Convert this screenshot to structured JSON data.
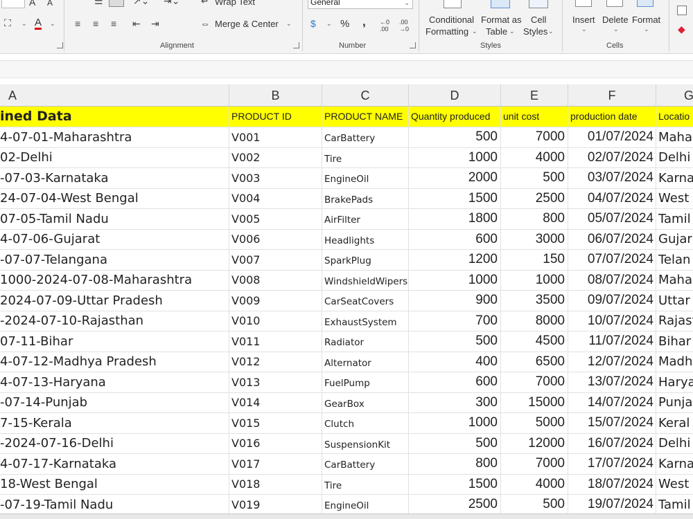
{
  "ribbon": {
    "font": {
      "grow": "A",
      "shrink": "A",
      "fill_icon": "paint-bucket-icon",
      "font_color_label": "A",
      "font_color": "#e00000"
    },
    "alignment": {
      "wrap_text": "Wrap Text",
      "merge_center": "Merge & Center",
      "group_label": "Alignment"
    },
    "number": {
      "format_value": "General",
      "percent": "%",
      "comma": ",",
      "inc_decimal": "←0 .00",
      "dec_decimal": ".00 →0",
      "group_label": "Number"
    },
    "styles": {
      "conditional_line1": "Conditional",
      "conditional_line2": "Formatting",
      "format_table_line1": "Format as",
      "format_table_line2": "Table",
      "cell_styles_line1": "Cell",
      "cell_styles_line2": "Styles",
      "group_label": "Styles"
    },
    "cells": {
      "insert": "Insert",
      "delete": "Delete",
      "format": "Format",
      "group_label": "Cells"
    }
  },
  "columns": [
    "A",
    "B",
    "C",
    "D",
    "E",
    "F",
    "G"
  ],
  "header_row": {
    "a": "ined Data",
    "b": "PRODUCT ID",
    "c": "PRODUCT NAME",
    "d": "Quantity produced",
    "e": "unit cost",
    "f": "production date",
    "g": "Locatio"
  },
  "rows": [
    {
      "a": "4-07-01-Maharashtra",
      "b": "V001",
      "c": "CarBattery",
      "d": "500",
      "e": "7000",
      "f": "01/07/2024",
      "g": "Maha"
    },
    {
      "a": "02-Delhi",
      "b": "V002",
      "c": "Tire",
      "d": "1000",
      "e": "4000",
      "f": "02/07/2024",
      "g": "Delhi"
    },
    {
      "a": "-07-03-Karnataka",
      "b": "V003",
      "c": "EngineOil",
      "d": "2000",
      "e": "500",
      "f": "03/07/2024",
      "g": "Karna"
    },
    {
      "a": "24-07-04-West Bengal",
      "b": "V004",
      "c": "BrakePads",
      "d": "1500",
      "e": "2500",
      "f": "04/07/2024",
      "g": "West"
    },
    {
      "a": "07-05-Tamil Nadu",
      "b": "V005",
      "c": "AirFilter",
      "d": "1800",
      "e": "800",
      "f": "05/07/2024",
      "g": "Tamil"
    },
    {
      "a": "4-07-06-Gujarat",
      "b": "V006",
      "c": "Headlights",
      "d": "600",
      "e": "3000",
      "f": "06/07/2024",
      "g": "Gujar"
    },
    {
      "a": "-07-07-Telangana",
      "b": "V007",
      "c": "SparkPlug",
      "d": "1200",
      "e": "150",
      "f": "07/07/2024",
      "g": "Telan"
    },
    {
      "a": "1000-2024-07-08-Maharashtra",
      "b": "V008",
      "c": "WindshieldWipers",
      "d": "1000",
      "e": "1000",
      "f": "08/07/2024",
      "g": "Maha"
    },
    {
      "a": "2024-07-09-Uttar Pradesh",
      "b": "V009",
      "c": "CarSeatCovers",
      "d": "900",
      "e": "3500",
      "f": "09/07/2024",
      "g": "Uttar"
    },
    {
      "a": "-2024-07-10-Rajasthan",
      "b": "V010",
      "c": "ExhaustSystem",
      "d": "700",
      "e": "8000",
      "f": "10/07/2024",
      "g": "Rajast"
    },
    {
      "a": "07-11-Bihar",
      "b": "V011",
      "c": "Radiator",
      "d": "500",
      "e": "4500",
      "f": "11/07/2024",
      "g": "Bihar"
    },
    {
      "a": "4-07-12-Madhya Pradesh",
      "b": "V012",
      "c": "Alternator",
      "d": "400",
      "e": "6500",
      "f": "12/07/2024",
      "g": "Madh"
    },
    {
      "a": "4-07-13-Haryana",
      "b": "V013",
      "c": "FuelPump",
      "d": "600",
      "e": "7000",
      "f": "13/07/2024",
      "g": "Harya"
    },
    {
      "a": "-07-14-Punjab",
      "b": "V014",
      "c": "GearBox",
      "d": "300",
      "e": "15000",
      "f": "14/07/2024",
      "g": "Punja"
    },
    {
      "a": "7-15-Kerala",
      "b": "V015",
      "c": "Clutch",
      "d": "1000",
      "e": "5000",
      "f": "15/07/2024",
      "g": "Keral"
    },
    {
      "a": "-2024-07-16-Delhi",
      "b": "V016",
      "c": "SuspensionKit",
      "d": "500",
      "e": "12000",
      "f": "16/07/2024",
      "g": "Delhi"
    },
    {
      "a": "4-07-17-Karnataka",
      "b": "V017",
      "c": "CarBattery",
      "d": "800",
      "e": "7000",
      "f": "17/07/2024",
      "g": "Karna"
    },
    {
      "a": "18-West Bengal",
      "b": "V018",
      "c": "Tire",
      "d": "1500",
      "e": "4000",
      "f": "18/07/2024",
      "g": "West"
    },
    {
      "a": "-07-19-Tamil Nadu",
      "b": "V019",
      "c": "EngineOil",
      "d": "2500",
      "e": "500",
      "f": "19/07/2024",
      "g": "Tamil"
    }
  ],
  "colors": {
    "header_fill": "#ffff00",
    "ribbon_bg": "#f3f3f3",
    "gridline": "#e1e1e1"
  }
}
